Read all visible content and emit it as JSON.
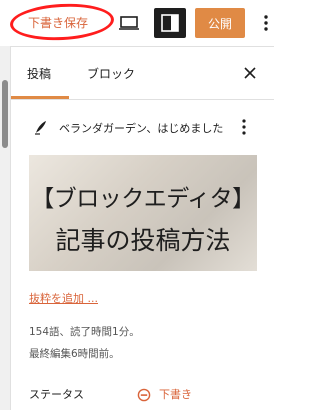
{
  "header": {
    "save_draft_label": "下書き保存",
    "publish_label": "公開"
  },
  "sidebar": {
    "tabs": [
      {
        "label": "投稿",
        "active": true
      },
      {
        "label": "ブロック",
        "active": false
      }
    ]
  },
  "post": {
    "title": "ベランダガーデン、はじめました",
    "featured_image": {
      "line1": "【ブロックエディタ】",
      "line2": "記事の投稿方法"
    },
    "excerpt_link": "抜粋を追加 ...",
    "stats_line1": "154語、読了時間1分。",
    "stats_line2": "最終編集6時間前。",
    "status_label": "ステータス",
    "status_value": "下書き"
  },
  "colors": {
    "accent": "#e08a45",
    "link": "#d9643a",
    "highlight_ring": "#ff1d1d",
    "dark": "#1e1e1e"
  },
  "icons": {
    "preview": "laptop-icon",
    "sidebar_toggle": "sidebar-toggle-icon",
    "more": "more-vertical-icon",
    "close": "close-icon",
    "post": "pen-icon",
    "status": "draft-status-icon"
  }
}
